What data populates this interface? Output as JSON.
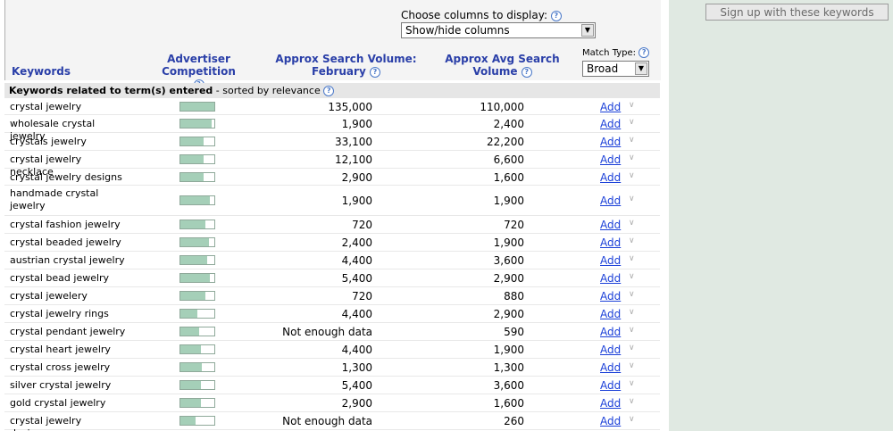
{
  "controls": {
    "columns_label": "Choose columns to display:",
    "columns_value": "Show/hide columns",
    "match_type_label": "Match Type:",
    "match_type_value": "Broad"
  },
  "headers": {
    "keywords": "Keywords",
    "competition_line1": "Advertiser",
    "competition_line2": "Competition",
    "search_volume_line1": "Approx Search Volume:",
    "search_volume_line2": "February",
    "avg_volume_line1": "Approx Avg Search",
    "avg_volume_line2": "Volume"
  },
  "section": {
    "title": "Keywords related to term(s) entered",
    "suffix": " - sorted by relevance"
  },
  "rows": [
    {
      "keyword": "crystal jewelry",
      "competition": 1.0,
      "search_volume": "135,000",
      "avg_volume": "110,000",
      "add": "Add"
    },
    {
      "keyword": "wholesale crystal jewelry",
      "competition": 0.93,
      "search_volume": "1,900",
      "avg_volume": "2,400",
      "add": "Add"
    },
    {
      "keyword": "crystals jewelry",
      "competition": 0.68,
      "search_volume": "33,100",
      "avg_volume": "22,200",
      "add": "Add"
    },
    {
      "keyword": "crystal jewelry necklace",
      "competition": 0.68,
      "search_volume": "12,100",
      "avg_volume": "6,600",
      "add": "Add"
    },
    {
      "keyword": "crystal jewelry designs",
      "competition": 0.68,
      "search_volume": "2,900",
      "avg_volume": "1,600",
      "add": "Add"
    },
    {
      "keyword": "handmade crystal jewelry",
      "competition": 0.88,
      "search_volume": "1,900",
      "avg_volume": "1,900",
      "add": "Add"
    },
    {
      "keyword": "crystal fashion jewelry",
      "competition": 0.73,
      "search_volume": "720",
      "avg_volume": "720",
      "add": "Add"
    },
    {
      "keyword": "crystal beaded jewelry",
      "competition": 0.83,
      "search_volume": "2,400",
      "avg_volume": "1,900",
      "add": "Add"
    },
    {
      "keyword": "austrian crystal jewelry",
      "competition": 0.78,
      "search_volume": "4,400",
      "avg_volume": "3,600",
      "add": "Add"
    },
    {
      "keyword": "crystal bead jewelry",
      "competition": 0.88,
      "search_volume": "5,400",
      "avg_volume": "2,900",
      "add": "Add"
    },
    {
      "keyword": "crystal jewelery",
      "competition": 0.73,
      "search_volume": "720",
      "avg_volume": "880",
      "add": "Add"
    },
    {
      "keyword": "crystal jewelry rings",
      "competition": 0.5,
      "search_volume": "4,400",
      "avg_volume": "2,900",
      "add": "Add"
    },
    {
      "keyword": "crystal pendant jewelry",
      "competition": 0.55,
      "search_volume": "Not enough data",
      "avg_volume": "590",
      "add": "Add"
    },
    {
      "keyword": "crystal heart jewelry",
      "competition": 0.6,
      "search_volume": "4,400",
      "avg_volume": "1,900",
      "add": "Add"
    },
    {
      "keyword": "crystal cross jewelry",
      "competition": 0.63,
      "search_volume": "1,300",
      "avg_volume": "1,300",
      "add": "Add"
    },
    {
      "keyword": "silver crystal jewelry",
      "competition": 0.6,
      "search_volume": "5,400",
      "avg_volume": "3,600",
      "add": "Add"
    },
    {
      "keyword": "gold crystal jewelry",
      "competition": 0.6,
      "search_volume": "2,900",
      "avg_volume": "1,600",
      "add": "Add"
    },
    {
      "keyword": "crystal jewelry designer",
      "competition": 0.45,
      "search_volume": "Not enough data",
      "avg_volume": "260",
      "add": "Add"
    }
  ],
  "sidebar": {
    "signup_button": "Sign up with these keywords"
  }
}
